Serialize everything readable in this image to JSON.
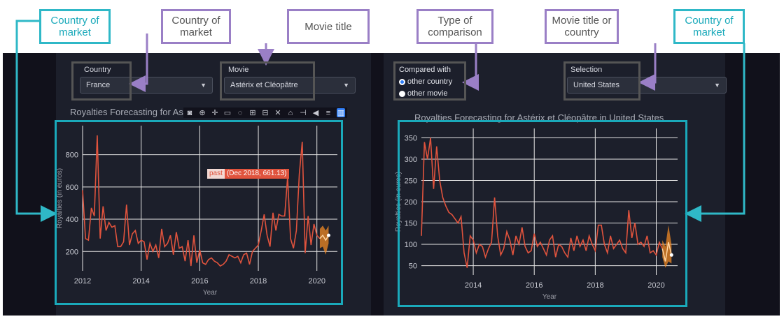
{
  "annotations": {
    "a1": "Country of market",
    "a2": "Country of market",
    "a3": "Movie title",
    "a4": "Type of comparison",
    "a5": "Movie title or country",
    "a6": "Country of market"
  },
  "left_controls": {
    "country_label": "Country",
    "country_value": "France",
    "movie_label": "Movie",
    "movie_value": "Astérix et Cléopâtre",
    "chart_title": "Royalties Forecasting for Astérix et Cléopâtre in France"
  },
  "right_controls": {
    "compared_label": "Compared with",
    "option_country": "other country",
    "option_movie": "other movie",
    "selected_option": "other country",
    "selection_label": "Selection",
    "selection_value": "United States",
    "chart_title": "Royalties Forecasting for Astérix et Cléopâtre in United States"
  },
  "tooltip": {
    "tag": "past",
    "text": "(Dec 2018, 661.13)"
  },
  "colors": {
    "past_line": "#e0533d",
    "forecast": "#f08a24",
    "annotation_cyan": "#2fb8c7",
    "annotation_purple": "#9a7fc6",
    "background": "#11111b"
  },
  "modebar_icons": [
    "camera-icon",
    "zoom-icon",
    "pan-icon",
    "select-icon",
    "lasso-icon",
    "zoom-in-icon",
    "zoom-out-icon",
    "autoscale-icon",
    "home-icon",
    "spike-icon",
    "hover-closest-icon",
    "hover-compare-icon",
    "plotly-logo-icon"
  ],
  "chart_data": [
    {
      "type": "line",
      "title": "Royalties Forecasting for Astérix et Cléopâtre in France",
      "xlabel": "Year",
      "ylabel": "Royalties (in euros)",
      "xlim": [
        2012,
        2020.7
      ],
      "ylim": [
        80,
        980
      ],
      "xticks": [
        2012,
        2014,
        2016,
        2018,
        2020
      ],
      "yticks": [
        200,
        400,
        600,
        800
      ],
      "series": [
        {
          "name": "past",
          "x": [
            2012.0,
            2012.1,
            2012.2,
            2012.3,
            2012.4,
            2012.5,
            2012.6,
            2012.7,
            2012.8,
            2012.9,
            2013.0,
            2013.1,
            2013.2,
            2013.3,
            2013.4,
            2013.5,
            2013.6,
            2013.7,
            2013.8,
            2013.9,
            2014.0,
            2014.1,
            2014.2,
            2014.3,
            2014.4,
            2014.5,
            2014.6,
            2014.7,
            2014.8,
            2014.9,
            2015.0,
            2015.1,
            2015.2,
            2015.3,
            2015.4,
            2015.5,
            2015.6,
            2015.7,
            2015.8,
            2015.9,
            2016.0,
            2016.1,
            2016.2,
            2016.3,
            2016.4,
            2016.5,
            2016.6,
            2016.7,
            2016.8,
            2016.9,
            2017.0,
            2017.1,
            2017.2,
            2017.3,
            2017.4,
            2017.5,
            2017.6,
            2017.7,
            2017.8,
            2017.9,
            2018.0,
            2018.1,
            2018.2,
            2018.3,
            2018.4,
            2018.5,
            2018.6,
            2018.7,
            2018.8,
            2018.9,
            2019.0,
            2019.1,
            2019.2,
            2019.3,
            2019.4,
            2019.5,
            2019.6,
            2019.7,
            2019.8,
            2019.9,
            2020.0,
            2020.1
          ],
          "y": [
            580,
            280,
            270,
            470,
            420,
            920,
            280,
            480,
            330,
            380,
            350,
            360,
            230,
            230,
            260,
            490,
            240,
            310,
            330,
            250,
            270,
            260,
            150,
            250,
            200,
            240,
            160,
            340,
            230,
            250,
            300,
            180,
            320,
            220,
            230,
            140,
            270,
            110,
            300,
            130,
            210,
            130,
            120,
            150,
            160,
            140,
            130,
            110,
            120,
            140,
            180,
            170,
            160,
            170,
            130,
            180,
            190,
            120,
            200,
            220,
            240,
            330,
            430,
            300,
            230,
            440,
            330,
            430,
            420,
            420,
            661,
            280,
            220,
            330,
            680,
            880,
            190,
            420,
            240,
            370,
            300,
            280
          ]
        },
        {
          "name": "forecast",
          "x": [
            2020.1,
            2020.2,
            2020.3,
            2020.4
          ],
          "y": [
            280,
            300,
            270,
            300
          ],
          "y_lower": [
            220,
            230,
            180,
            250
          ],
          "y_upper": [
            340,
            360,
            330,
            360
          ]
        }
      ]
    },
    {
      "type": "line",
      "title": "Royalties Forecasting for Astérix et Cléopâtre in United States",
      "xlabel": "Year",
      "ylabel": "Royalties (in euros)",
      "xlim": [
        2012.3,
        2020.7
      ],
      "ylim": [
        28,
        372
      ],
      "xticks": [
        2014,
        2016,
        2018,
        2020
      ],
      "yticks": [
        50,
        100,
        150,
        200,
        250,
        300,
        350
      ],
      "series": [
        {
          "name": "past",
          "x": [
            2012.3,
            2012.4,
            2012.5,
            2012.6,
            2012.7,
            2012.8,
            2012.9,
            2013.0,
            2013.1,
            2013.2,
            2013.3,
            2013.4,
            2013.5,
            2013.6,
            2013.7,
            2013.8,
            2013.9,
            2014.0,
            2014.1,
            2014.2,
            2014.3,
            2014.4,
            2014.5,
            2014.6,
            2014.7,
            2014.8,
            2014.9,
            2015.0,
            2015.1,
            2015.2,
            2015.3,
            2015.4,
            2015.5,
            2015.6,
            2015.7,
            2015.8,
            2015.9,
            2016.0,
            2016.1,
            2016.2,
            2016.3,
            2016.4,
            2016.5,
            2016.6,
            2016.7,
            2016.8,
            2016.9,
            2017.0,
            2017.1,
            2017.2,
            2017.3,
            2017.4,
            2017.5,
            2017.6,
            2017.7,
            2017.8,
            2017.9,
            2018.0,
            2018.1,
            2018.2,
            2018.3,
            2018.4,
            2018.5,
            2018.6,
            2018.7,
            2018.8,
            2018.9,
            2019.0,
            2019.1,
            2019.2,
            2019.3,
            2019.4,
            2019.5,
            2019.6,
            2019.7,
            2019.8,
            2019.9,
            2020.0,
            2020.1,
            2020.2
          ],
          "y": [
            120,
            340,
            300,
            350,
            230,
            330,
            250,
            210,
            190,
            175,
            170,
            160,
            150,
            165,
            80,
            45,
            120,
            110,
            80,
            100,
            95,
            70,
            90,
            105,
            210,
            120,
            75,
            90,
            130,
            110,
            75,
            120,
            100,
            140,
            95,
            80,
            85,
            125,
            95,
            105,
            90,
            75,
            110,
            120,
            70,
            100,
            95,
            80,
            70,
            115,
            85,
            120,
            95,
            110,
            85,
            120,
            100,
            85,
            145,
            145,
            100,
            80,
            120,
            90,
            100,
            110,
            90,
            80,
            180,
            115,
            150,
            100,
            105,
            95,
            120,
            80,
            85,
            75,
            105,
            90
          ]
        },
        {
          "name": "forecast",
          "x": [
            2020.2,
            2020.3,
            2020.4,
            2020.5
          ],
          "y": [
            90,
            60,
            105,
            75
          ],
          "y_lower": [
            70,
            45,
            60,
            55
          ],
          "y_upper": [
            110,
            95,
            145,
            100
          ]
        }
      ]
    }
  ]
}
